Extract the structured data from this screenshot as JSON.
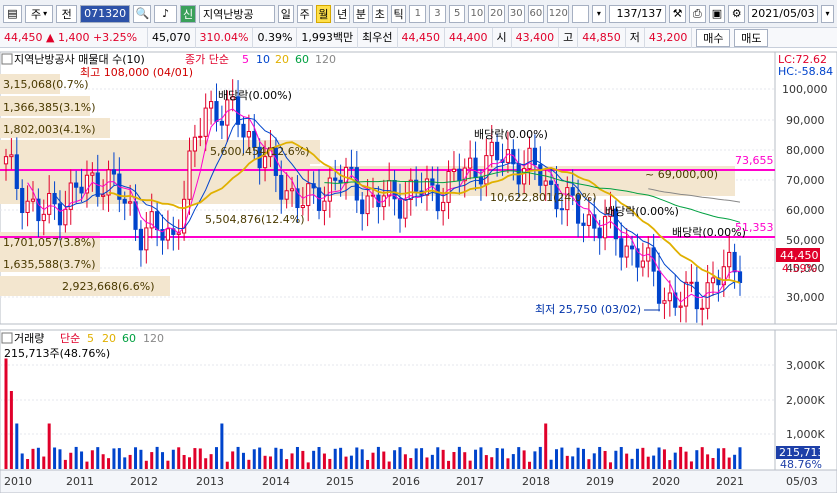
{
  "toolbar": {
    "market": "주",
    "type": "전",
    "code": "071320",
    "search_icon": "magnifier-icon",
    "sound_icon": "speaker-icon",
    "credit_badge": "신",
    "name": "지역난방공",
    "periods": [
      "일",
      "주",
      "월",
      "년",
      "분",
      "초",
      "틱"
    ],
    "active_period": "월",
    "intervals": [
      "1",
      "3",
      "5",
      "10",
      "20",
      "30",
      "60",
      "120"
    ],
    "count": "137/137",
    "date": "2021/05/03"
  },
  "infobar": {
    "price": "44,450",
    "change_arrow": "▲",
    "change": "1,400",
    "change_rate": "+3.25%",
    "volume": "45,070",
    "vol_ratio": "310.04%",
    "turnover": "0.39%",
    "amount": "1,993백만",
    "best_quote_label": "최우선",
    "ask": "44,450",
    "bid": "44,400",
    "open_label": "시",
    "open": "43,400",
    "high_label": "고",
    "high": "44,850",
    "low_label": "저",
    "low": "43,200",
    "buy_label": "매수",
    "sell_label": "매도"
  },
  "price_chart": {
    "legend_title": "지역난방공사 매물대 수(10)",
    "legend_close": "종가 단순",
    "ma_periods": [
      "5",
      "10",
      "20",
      "60",
      "120"
    ],
    "lc_label": "LC:72.62",
    "hc_label": "HC:-58.84",
    "y_ticks": [
      "100,000",
      "90,000",
      "80,000",
      "70,000",
      "60,000",
      "50,000",
      "40,000",
      "30,000"
    ],
    "resistance_value": "73,655",
    "support_value": "51,353",
    "current_price": "44,450",
    "current_pct": "4.59%",
    "high_annotation": "최고 108,000 (04/01)",
    "low_annotation": "최저 25,750 (03/02)",
    "dividend_label": "배당락(0.00%)",
    "dividend_label2": "배당락",
    "box_range": "~ 69,000,00)",
    "volume_profile": [
      "3,15,068(0.7%)",
      "1,366,385(3.1%)",
      "1,802,003(4.1%)",
      "5,600,454(12.6%)",
      "5,504,876(12.4%)",
      "10,622,801(24.0%)",
      "1,701,057(3.8%)",
      "1,635,588(3.7%)",
      "2,923,668(6.6%)"
    ]
  },
  "volume_chart": {
    "legend_title": "거래량",
    "legend_ma": "단순",
    "ma_periods": [
      "5",
      "20",
      "60",
      "120"
    ],
    "max_note": "215,713주(48.76%)",
    "y_ticks": [
      "3,000K",
      "2,000K",
      "1,000K"
    ],
    "current_volume": "215,713",
    "current_pct": "48.76%"
  },
  "x_axis": [
    "2010",
    "2011",
    "2012",
    "2013",
    "2014",
    "2015",
    "2016",
    "2017",
    "2018",
    "2019",
    "2020",
    "2021",
    "05/03"
  ],
  "chart_data": {
    "type": "candlestick",
    "timeframe": "monthly",
    "y_range": [
      25000,
      110000
    ],
    "highest": {
      "value": 108000,
      "date": "04/01"
    },
    "lowest": {
      "value": 25750,
      "date": "03/02"
    },
    "last_close": 44450,
    "resistance": 73655,
    "support": 51353,
    "closes": [
      {
        "year": "2010",
        "value": 75000
      },
      {
        "year": "2010.5",
        "value": 58000
      },
      {
        "year": "2011",
        "value": 66000
      },
      {
        "year": "2011.5",
        "value": 72000
      },
      {
        "year": "2012",
        "value": 55000
      },
      {
        "year": "2012.5",
        "value": 52000
      },
      {
        "year": "2013",
        "value": 95000
      },
      {
        "year": "2013.5",
        "value": 90000
      },
      {
        "year": "2014",
        "value": 72000
      },
      {
        "year": "2014.5",
        "value": 62000
      },
      {
        "year": "2015",
        "value": 72000
      },
      {
        "year": "2015.5",
        "value": 63000
      },
      {
        "year": "2016",
        "value": 66000
      },
      {
        "year": "2016.5",
        "value": 67000
      },
      {
        "year": "2017",
        "value": 75000
      },
      {
        "year": "2017.5",
        "value": 78000
      },
      {
        "year": "2018",
        "value": 72000
      },
      {
        "year": "2018.5",
        "value": 60000
      },
      {
        "year": "2019",
        "value": 55000
      },
      {
        "year": "2019.5",
        "value": 45000
      },
      {
        "year": "2020",
        "value": 30000
      },
      {
        "year": "2020.5",
        "value": 35000
      },
      {
        "year": "2021",
        "value": 44450
      }
    ]
  }
}
